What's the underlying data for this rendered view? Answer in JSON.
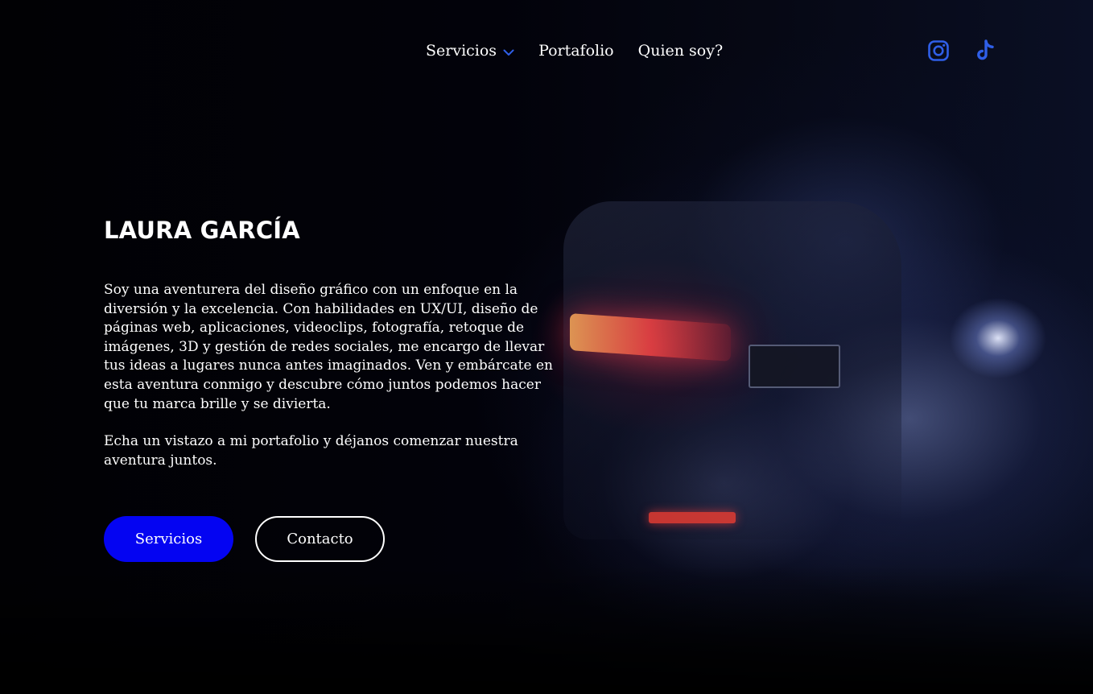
{
  "nav": {
    "items": [
      {
        "label": "Servicios",
        "has_dropdown": true
      },
      {
        "label": "Portafolio"
      },
      {
        "label": "Quien soy?"
      }
    ]
  },
  "social": {
    "icons": [
      "instagram-icon",
      "tiktok-icon"
    ],
    "color": "#2f5fe8"
  },
  "hero": {
    "title": "LAURA GARCÍA",
    "paragraph1": "Soy una aventurera del diseño gráfico con un enfoque en la diversión y la excelencia. Con habilidades en UX/UI, diseño de páginas web, aplicaciones, videoclips, fotografía, retoque de imágenes, 3D y gestión de redes sociales, me encargo de llevar tus ideas a lugares nunca antes imaginados. Ven y embárcate en esta aventura conmigo y descubre cómo juntos podemos hacer que tu marca brille y se divierta.",
    "paragraph2": "Echa un vistazo a mi portafolio y déjanos comenzar nuestra aventura juntos."
  },
  "buttons": {
    "primary_label": "Servicios",
    "secondary_label": "Contacto",
    "primary_color": "#0404f2"
  }
}
